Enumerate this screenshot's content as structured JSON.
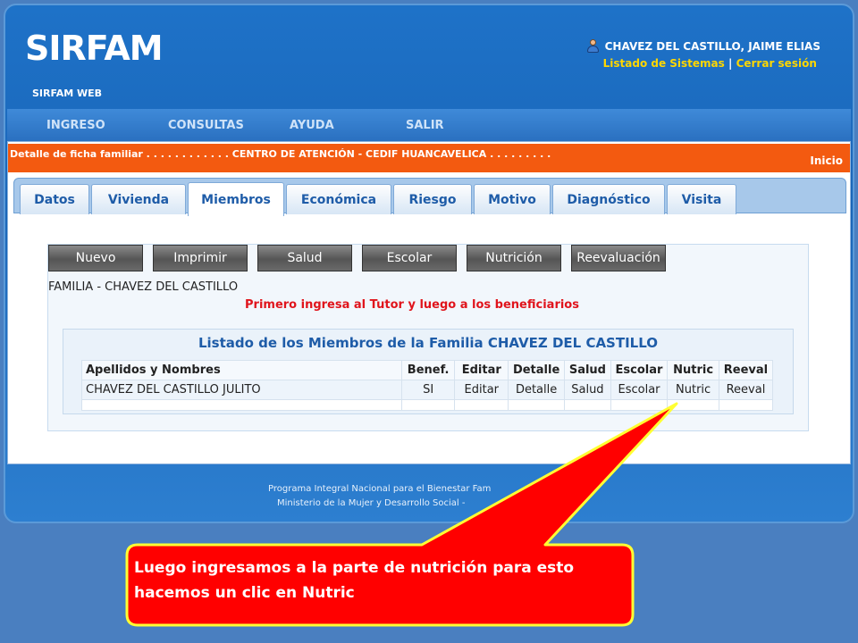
{
  "app": {
    "logo": "SIRFAM",
    "subtitle": "SIRFAM WEB",
    "user_name": "CHAVEZ DEL CASTILLO, JAIME ELIAS",
    "link_systems": "Listado de Sistemas",
    "link_separator": "|",
    "link_logout": "Cerrar sesión"
  },
  "menu": [
    "INGRESO",
    "CONSULTAS",
    "AYUDA",
    "SALIR"
  ],
  "breadcrumb": {
    "text": "Detalle de ficha familiar . . . . . . . . . . . . CENTRO DE ATENCIÓN - CEDIF HUANCAVELICA . . . . . . . . .",
    "home": "Inicio"
  },
  "tabs": [
    "Datos",
    "Vivienda",
    "Miembros",
    "Económica",
    "Riesgo",
    "Motivo",
    "Diagnóstico",
    "Visita"
  ],
  "active_tab": "Miembros",
  "buttons": [
    "Nuevo",
    "Imprimir",
    "Salud",
    "Escolar",
    "Nutrición",
    "Reevaluación"
  ],
  "family_label": "FAMILIA - CHAVEZ DEL CASTILLO",
  "warning": "Primero ingresa al Tutor y luego a los beneficiarios",
  "members_table": {
    "title": "Listado de los Miembros de la Familia CHAVEZ DEL CASTILLO",
    "headers": [
      "Apellidos y Nombres",
      "Benef.",
      "Editar",
      "Detalle",
      "Salud",
      "Escolar",
      "Nutric",
      "Reeval"
    ],
    "rows": [
      [
        "CHAVEZ DEL CASTILLO JULITO",
        "SI",
        "Editar",
        "Detalle",
        "Salud",
        "Escolar",
        "Nutric",
        "Reeval"
      ]
    ]
  },
  "footer": {
    "line1": "Programa Integral Nacional para el Bienestar Fam",
    "line2": "Ministerio de la Mujer y Desarrollo Social -"
  },
  "callout": {
    "text": "Luego ingresamos a la parte de nutrición para esto hacemos un clic en Nutric"
  },
  "colors": {
    "accent_orange": "#f35a10",
    "brand_blue": "#1e5ca8",
    "callout_red": "#ff0000",
    "callout_border": "#ffff33"
  }
}
